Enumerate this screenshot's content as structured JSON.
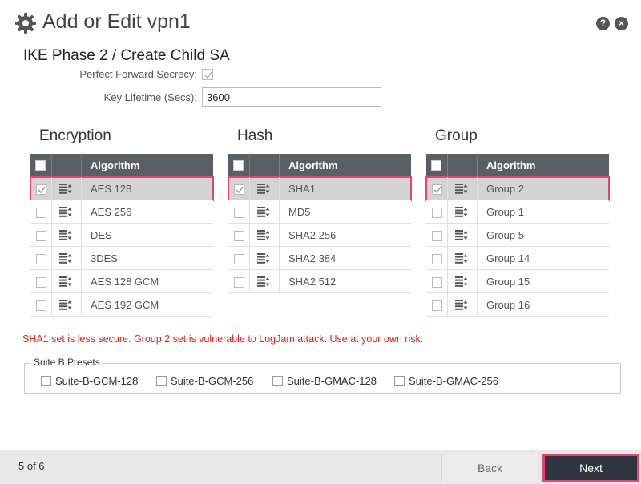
{
  "window": {
    "title": "Add or Edit vpn1",
    "title_icon": "gear-icon",
    "help_icon": "?",
    "close_icon": "×"
  },
  "section": {
    "title": "IKE Phase 2 / Create Child SA"
  },
  "pfs": {
    "label": "Perfect Forward Secrecy:",
    "checked": true
  },
  "key_lifetime": {
    "label": "Key Lifetime (Secs):",
    "value": "3600"
  },
  "encryption": {
    "title": "Encryption",
    "header": "Algorithm",
    "rows": [
      {
        "label": "AES 128",
        "checked": true,
        "selected": true
      },
      {
        "label": "AES 256",
        "checked": false,
        "selected": false
      },
      {
        "label": "DES",
        "checked": false,
        "selected": false
      },
      {
        "label": "3DES",
        "checked": false,
        "selected": false
      },
      {
        "label": "AES 128 GCM",
        "checked": false,
        "selected": false
      },
      {
        "label": "AES 192 GCM",
        "checked": false,
        "selected": false
      }
    ]
  },
  "hash": {
    "title": "Hash",
    "header": "Algorithm",
    "rows": [
      {
        "label": "SHA1",
        "checked": true,
        "selected": true
      },
      {
        "label": "MD5",
        "checked": false,
        "selected": false
      },
      {
        "label": "SHA2 256",
        "checked": false,
        "selected": false
      },
      {
        "label": "SHA2 384",
        "checked": false,
        "selected": false
      },
      {
        "label": "SHA2 512",
        "checked": false,
        "selected": false
      }
    ]
  },
  "group": {
    "title": "Group",
    "header": "Algorithm",
    "rows": [
      {
        "label": "Group 2",
        "checked": true,
        "selected": true
      },
      {
        "label": "Group 1",
        "checked": false,
        "selected": false
      },
      {
        "label": "Group 5",
        "checked": false,
        "selected": false
      },
      {
        "label": "Group 14",
        "checked": false,
        "selected": false
      },
      {
        "label": "Group 15",
        "checked": false,
        "selected": false
      },
      {
        "label": "Group 16",
        "checked": false,
        "selected": false
      }
    ]
  },
  "warning": "SHA1 set is less secure. Group 2 set is vulnerable to LogJam attack. Use at your own risk.",
  "suite_b": {
    "legend": "Suite B Presets",
    "options": [
      "Suite-B-GCM-128",
      "Suite-B-GCM-256",
      "Suite-B-GMAC-128",
      "Suite-B-GMAC-256"
    ]
  },
  "footer": {
    "page_count": "5 of 6",
    "back_label": "Back",
    "next_label": "Next"
  },
  "colors": {
    "header_bg": "#5a5f66",
    "highlight": "#e9426f",
    "warning": "#e8201e",
    "next_bg": "#2d3640"
  }
}
